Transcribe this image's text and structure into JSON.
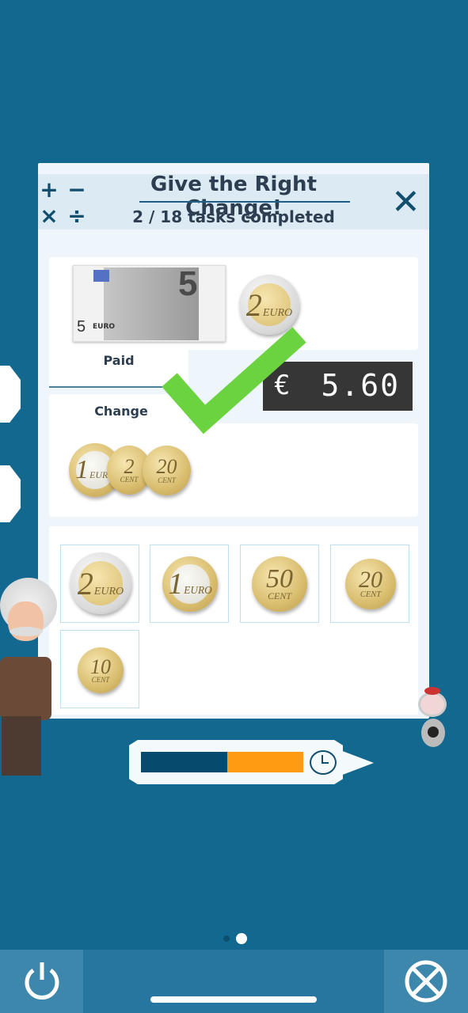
{
  "header": {
    "title": "Give the Right Change!",
    "subtitle": "2 / 18 tasks completed",
    "operators": [
      "+",
      "−",
      "×",
      "÷"
    ],
    "close_icon": "close-icon"
  },
  "paid": {
    "label": "Paid",
    "banknote": {
      "value": "5",
      "unit": "EURO"
    },
    "coins": [
      {
        "value": "2",
        "unit": "EURO"
      }
    ]
  },
  "change": {
    "label": "Change",
    "coins": [
      {
        "value": "1",
        "unit": "EURO"
      },
      {
        "value": "2",
        "unit": "CENT"
      },
      {
        "value": "20",
        "unit": "CENT"
      }
    ]
  },
  "price_display": {
    "currency": "€",
    "amount": "5.60"
  },
  "feedback": {
    "icon": "checkmark-icon",
    "color": "#6bd33f"
  },
  "coin_tray": [
    {
      "value": "2",
      "unit": "EURO"
    },
    {
      "value": "1",
      "unit": "EURO"
    },
    {
      "value": "50",
      "unit": "CENT"
    },
    {
      "value": "20",
      "unit": "CENT"
    },
    {
      "value": "10",
      "unit": "CENT"
    }
  ],
  "timer": {
    "elapsed_fraction": 0.53,
    "elapsed_color": "#064b6e",
    "remaining_color": "#ff9b12",
    "icon": "clock-icon"
  },
  "pager": {
    "pages": 2,
    "current": 2
  },
  "bottom_bar": {
    "left_icon": "power-icon",
    "right_icon": "no-tools-icon"
  }
}
